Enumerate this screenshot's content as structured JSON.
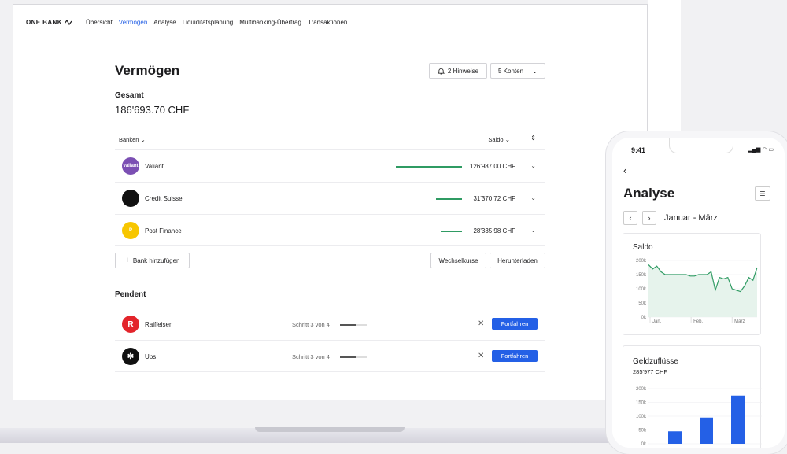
{
  "brand": {
    "name": "ONE BANK"
  },
  "nav": {
    "items": [
      "Übersicht",
      "Vermögen",
      "Analyse",
      "Liquiditätsplanung",
      "Multibanking-Übertrag",
      "Transaktionen"
    ]
  },
  "page": {
    "title": "Vermögen",
    "hints_label": "2 Hinweise",
    "accounts_label": "5 Konten"
  },
  "total": {
    "label": "Gesamt",
    "value": "186'693.70 CHF"
  },
  "table": {
    "col_bank": "Banken",
    "col_saldo": "Saldo"
  },
  "banks": [
    {
      "name": "Valiant",
      "logo_text": "valiant",
      "amount": "126'987.00 CHF",
      "share": 1.0,
      "color": "#7b4fb3"
    },
    {
      "name": "Credit Suisse",
      "logo_text": "",
      "amount": "31'370.72 CHF",
      "share": 0.25,
      "color": "#111111"
    },
    {
      "name": "Post Finance",
      "logo_text": "P",
      "amount": "28'335.98 CHF",
      "share": 0.18,
      "color": "#f7c600"
    }
  ],
  "actions": {
    "add_bank": "Bank hinzufügen",
    "rates": "Wechselkurse",
    "download": "Herunterladen"
  },
  "pending": {
    "label": "Pendent",
    "items": [
      {
        "name": "Raiffeisen",
        "logo_text": "R",
        "color": "#e3242b",
        "step": "Schritt 3 von 4",
        "progress": 0.6,
        "button": "Fortfahren"
      },
      {
        "name": "Ubs",
        "logo_text": "✻",
        "color": "#111111",
        "step": "Schritt 3 von 4",
        "progress": 0.6,
        "button": "Fortfahren"
      }
    ]
  },
  "phone": {
    "time": "9:41",
    "title": "Analyse",
    "period": "Januar - März",
    "saldo": {
      "label": "Saldo"
    },
    "inflow": {
      "label": "Geldzuflüsse",
      "total": "285'977 CHF"
    }
  },
  "chart_data": [
    {
      "type": "area",
      "title": "Saldo",
      "y_ticks": [
        "200k",
        "150k",
        "100k",
        "50k",
        "0k"
      ],
      "x_ticks": [
        "Jan.",
        "Feb.",
        "März"
      ],
      "ylim": [
        0,
        200000
      ],
      "values": [
        185000,
        170000,
        180000,
        160000,
        150000,
        150000,
        150000,
        150000,
        150000,
        150000,
        145000,
        145000,
        150000,
        150000,
        150000,
        160000,
        95000,
        140000,
        135000,
        140000,
        100000,
        95000,
        90000,
        110000,
        140000,
        130000,
        175000
      ]
    },
    {
      "type": "bar",
      "title": "Geldzuflüsse",
      "y_ticks": [
        "200k",
        "150k",
        "100k",
        "50k",
        "0k"
      ],
      "ylim": [
        0,
        200000
      ],
      "values": [
        45000,
        95000,
        175000
      ]
    }
  ]
}
